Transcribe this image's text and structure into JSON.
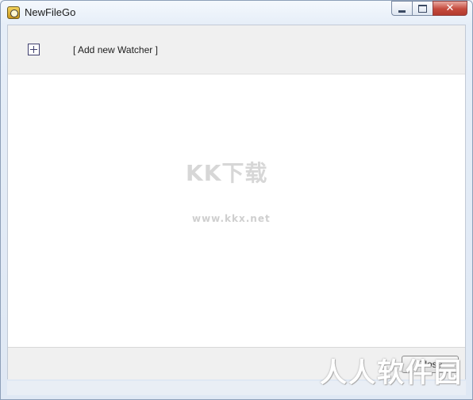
{
  "window": {
    "title": "NewFileGo",
    "icon": "app-eye-icon",
    "controls": {
      "minimize": "minimize-icon",
      "maximize": "maximize-icon",
      "close_label": "✕"
    }
  },
  "toolbar": {
    "add_icon": "plus-box-icon",
    "add_label": "[ Add new Watcher ]"
  },
  "watermarks": {
    "center_main": "KK下载",
    "center_url": "www.kkx.net",
    "corner": "人人软件园"
  },
  "bottom": {
    "button_label": "Close"
  },
  "colors": {
    "client_background": "#ffffff",
    "panel_background": "#f0f0f0",
    "close_button": "#c54a3d"
  }
}
